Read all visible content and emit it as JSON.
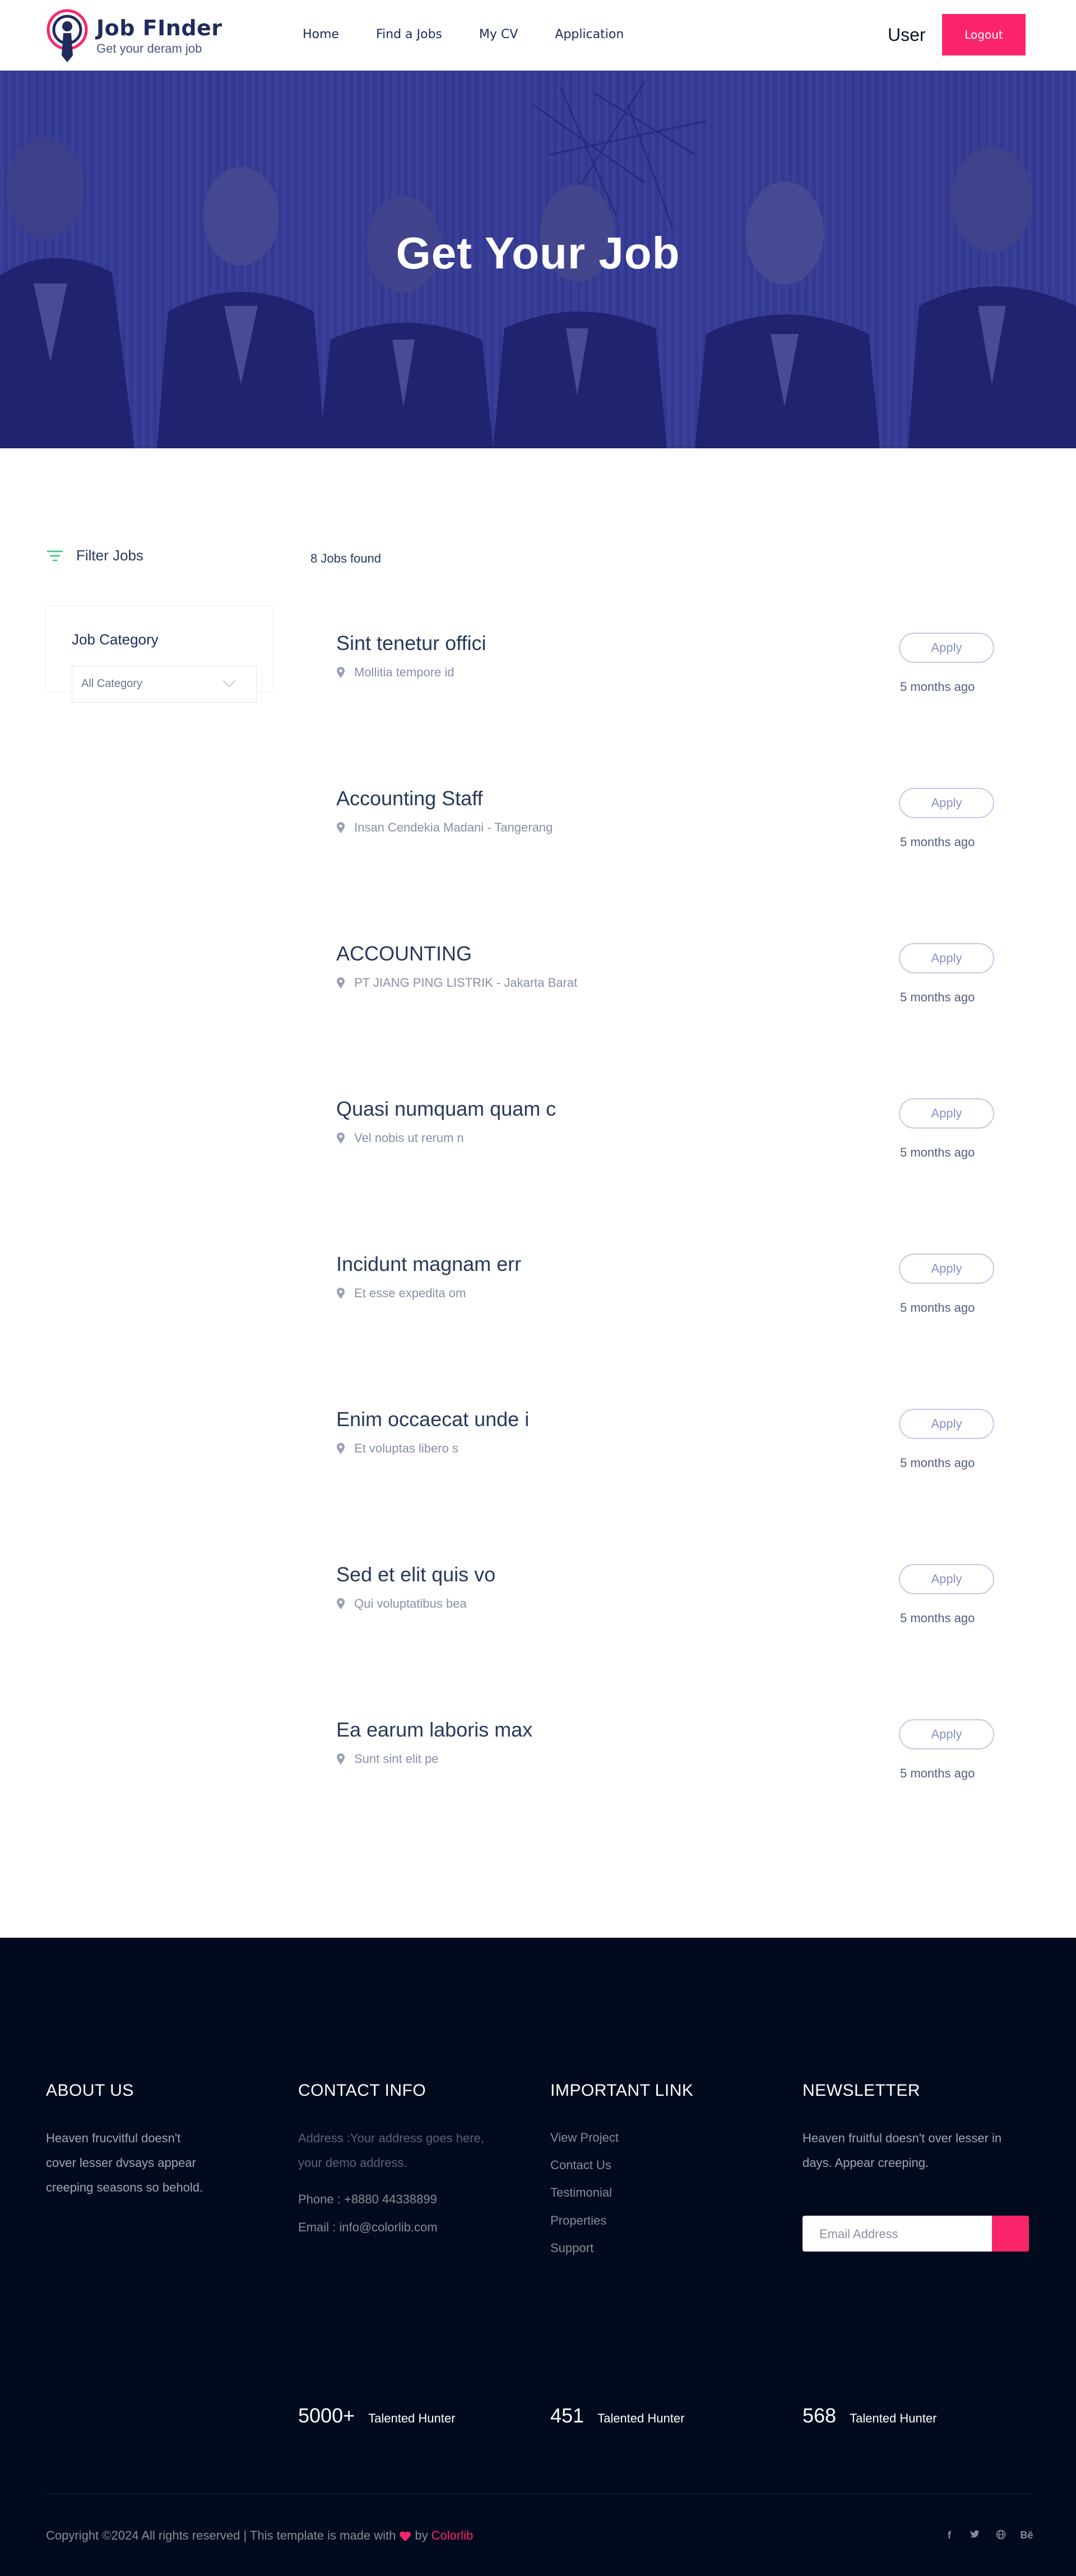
{
  "header": {
    "brand_title": "Job FInder",
    "brand_subtitle": "Get your deram job",
    "nav": [
      "Home",
      "Find a Jobs",
      "My CV",
      "Application"
    ],
    "user_label": "User",
    "logout_label": "Logout"
  },
  "hero": {
    "title": "Get Your Job"
  },
  "filter": {
    "heading": "Filter Jobs",
    "category_title": "Job Category",
    "category_selected": "All Category"
  },
  "results": {
    "count_text": "8 Jobs found",
    "apply_label": "Apply",
    "jobs": [
      {
        "title": "Sint tenetur offici",
        "location": "Mollitia tempore id",
        "posted": "5 months ago"
      },
      {
        "title": "Accounting Staff",
        "location": "Insan Cendekia Madani - Tangerang",
        "posted": "5 months ago"
      },
      {
        "title": "ACCOUNTING",
        "location": "PT JIANG PING LISTRIK - Jakarta Barat",
        "posted": "5 months ago"
      },
      {
        "title": "Quasi numquam quam c",
        "location": "Vel nobis ut rerum n",
        "posted": "5 months ago"
      },
      {
        "title": "Incidunt magnam err",
        "location": "Et esse expedita om",
        "posted": "5 months ago"
      },
      {
        "title": "Enim occaecat unde i",
        "location": "Et voluptas libero s",
        "posted": "5 months ago"
      },
      {
        "title": "Sed et elit quis vo",
        "location": "Qui voluptatibus bea",
        "posted": "5 months ago"
      },
      {
        "title": "Ea earum laboris max",
        "location": "Sunt sint elit pe",
        "posted": "5 months ago"
      }
    ]
  },
  "footer": {
    "about": {
      "title": "ABOUT US",
      "lines": [
        "Heaven frucvitful doesn't",
        "cover lesser dvsays appear",
        "creeping seasons so behold."
      ]
    },
    "contact": {
      "title": "CONTACT INFO",
      "address_lines": [
        "Address :Your address goes here,",
        "your demo address."
      ],
      "phone": "Phone : +8880 44338899",
      "email": "Email : info@colorlib.com"
    },
    "links": {
      "title": "IMPORTANT LINK",
      "items": [
        "View Project",
        "Contact Us",
        "Testimonial",
        "Properties",
        "Support"
      ]
    },
    "newsletter": {
      "title": "NEWSLETTER",
      "lines": [
        "Heaven fruitful doesn't over lesser in",
        "days. Appear creeping."
      ],
      "email_placeholder": "Email Address"
    },
    "stats": [
      {
        "number": "5000+",
        "label": "Talented Hunter"
      },
      {
        "number": "451",
        "label": "Talented Hunter"
      },
      {
        "number": "568",
        "label": "Talented Hunter"
      }
    ],
    "copyright_prefix": "Copyright ©2024 All rights reserved | This template is made with",
    "copyright_by": "by",
    "copyright_brand": "Colorlib",
    "socials": [
      "f",
      "t",
      "globe",
      "Bē"
    ]
  },
  "colors": {
    "accent": "#fb246a",
    "navy": "#1f2b5c",
    "hero_overlay": "#2f3590",
    "footer_bg": "#010b1d"
  }
}
